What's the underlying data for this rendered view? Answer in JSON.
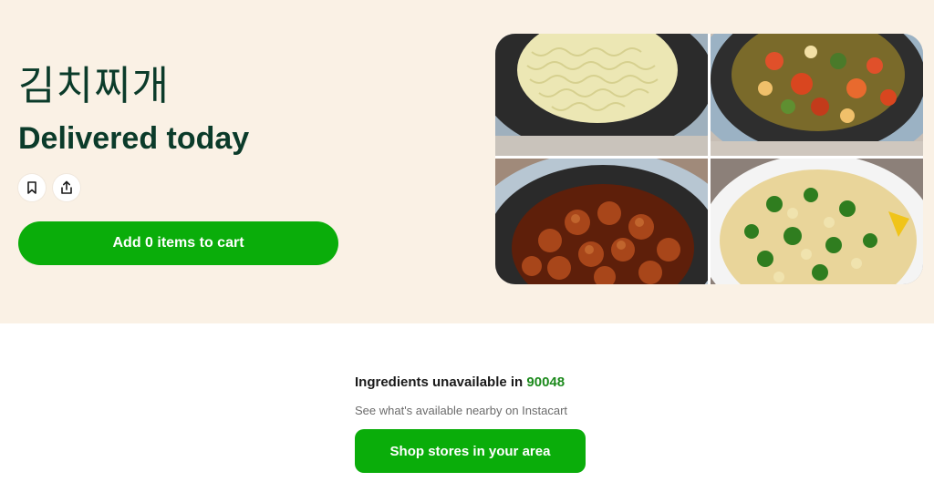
{
  "recipe": {
    "title": "김치찌개",
    "delivery_text": "Delivered today"
  },
  "actions": {
    "bookmark_icon": "bookmark-icon",
    "share_icon": "share-icon",
    "add_to_cart_label": "Add 0 items to cart"
  },
  "gallery": {
    "photos": [
      "noodles-in-pan",
      "vegetable-stir-fry-in-pot",
      "glazed-chicken-in-pan",
      "gnocchi-with-greens-and-lemon"
    ]
  },
  "availability": {
    "message": "Ingredients unavailable in ",
    "zip_code": "90048",
    "hint": "See what's available nearby on Instacart",
    "shop_button_label": "Shop stores in your area"
  },
  "colors": {
    "hero_background": "#faf1e5",
    "brand_green": "#0aad0a",
    "title_green": "#0b3b2a",
    "zip_green": "#1c8a1c"
  }
}
